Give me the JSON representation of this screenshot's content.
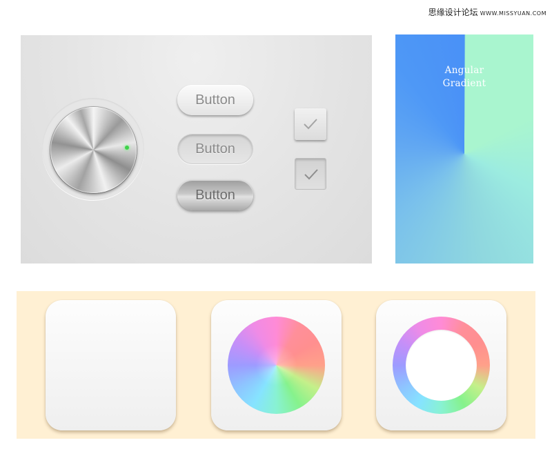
{
  "watermark": {
    "text_cn": "思缘设计论坛",
    "url": "WWW.MISSYUAN.COM"
  },
  "controls": {
    "buttons": [
      {
        "label": "Button",
        "state": "raised"
      },
      {
        "label": "Button",
        "state": "pressed"
      },
      {
        "label": "Button",
        "state": "metallic"
      }
    ],
    "checkboxes": [
      {
        "checked": true,
        "state": "raised"
      },
      {
        "checked": true,
        "state": "pressed"
      }
    ],
    "knob": {
      "indicator_color": "#3ed24a"
    }
  },
  "angular_card": {
    "title_line1": "Angular",
    "title_line2": "Gradient"
  },
  "icons": [
    {
      "name": "blank-tile"
    },
    {
      "name": "color-wheel-tile"
    },
    {
      "name": "color-ring-tile"
    }
  ],
  "colors": {
    "strip_background": "#fff0d3",
    "panel_background": "#e4e4e4",
    "gradient_blue": "#4a91f7",
    "gradient_mint": "#a9f5cf"
  }
}
